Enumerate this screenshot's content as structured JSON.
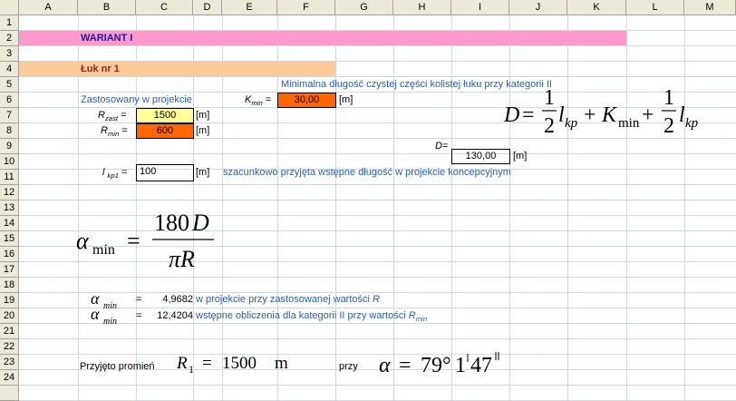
{
  "columns": [
    "A",
    "B",
    "C",
    "D",
    "E",
    "F",
    "G",
    "H",
    "I",
    "J",
    "K",
    "L",
    "M"
  ],
  "rows": [
    "1",
    "2",
    "3",
    "4",
    "5",
    "6",
    "7",
    "8",
    "9",
    "10",
    "11",
    "12",
    "13",
    "14",
    "15",
    "16",
    "17",
    "18",
    "19",
    "20",
    "21",
    "22",
    "23",
    "24"
  ],
  "colors": {
    "pink_band": "#ff99cc",
    "orange_band": "#ffcc99",
    "input_yellow": "#ffff99",
    "input_orange": "#ff6600",
    "blue_text": "#2a5db0"
  },
  "title": "WARIANT I",
  "subtitle": "Łuk nr 1",
  "min_length_label": "Minimalna długość czystej części kolistej łuku przy kategorii II",
  "applied_label": "Zastosowany w projekcie",
  "kmin_label": "K",
  "kmin_sub": "min",
  "kmin_value": "30,00",
  "unit_m": "[m]",
  "rzast_label": "R",
  "rzast_sub": "zast",
  "rzast_value": "1500",
  "rmin_label": "R",
  "rmin_sub": "min",
  "rmin_value": "600",
  "d_label": "D",
  "d_value": "130,00",
  "lkp1_label": "l",
  "lkp1_sub": "kp1",
  "lkp1_value": "100",
  "lkp1_note": "szacunkowo przyjęta wstępne długość w projekcie koncepcyjnym",
  "alpha1_value": "4,9682",
  "alpha1_note": "w projekcie przy zastosowanej wartości",
  "alpha1_note_var": "R",
  "alpha2_value": "12,4204",
  "alpha2_note": "wstępne obliczenia dla kategorii II przy wartości",
  "alpha2_note_var": "R",
  "alpha2_note_sub": "min",
  "radius_label": "Przyjęto promień",
  "radius_value": "1500",
  "radius_unit": "m",
  "przy_label": "przy",
  "alpha_deg": "79°",
  "alpha_min": "1",
  "alpha_sec": "47"
}
